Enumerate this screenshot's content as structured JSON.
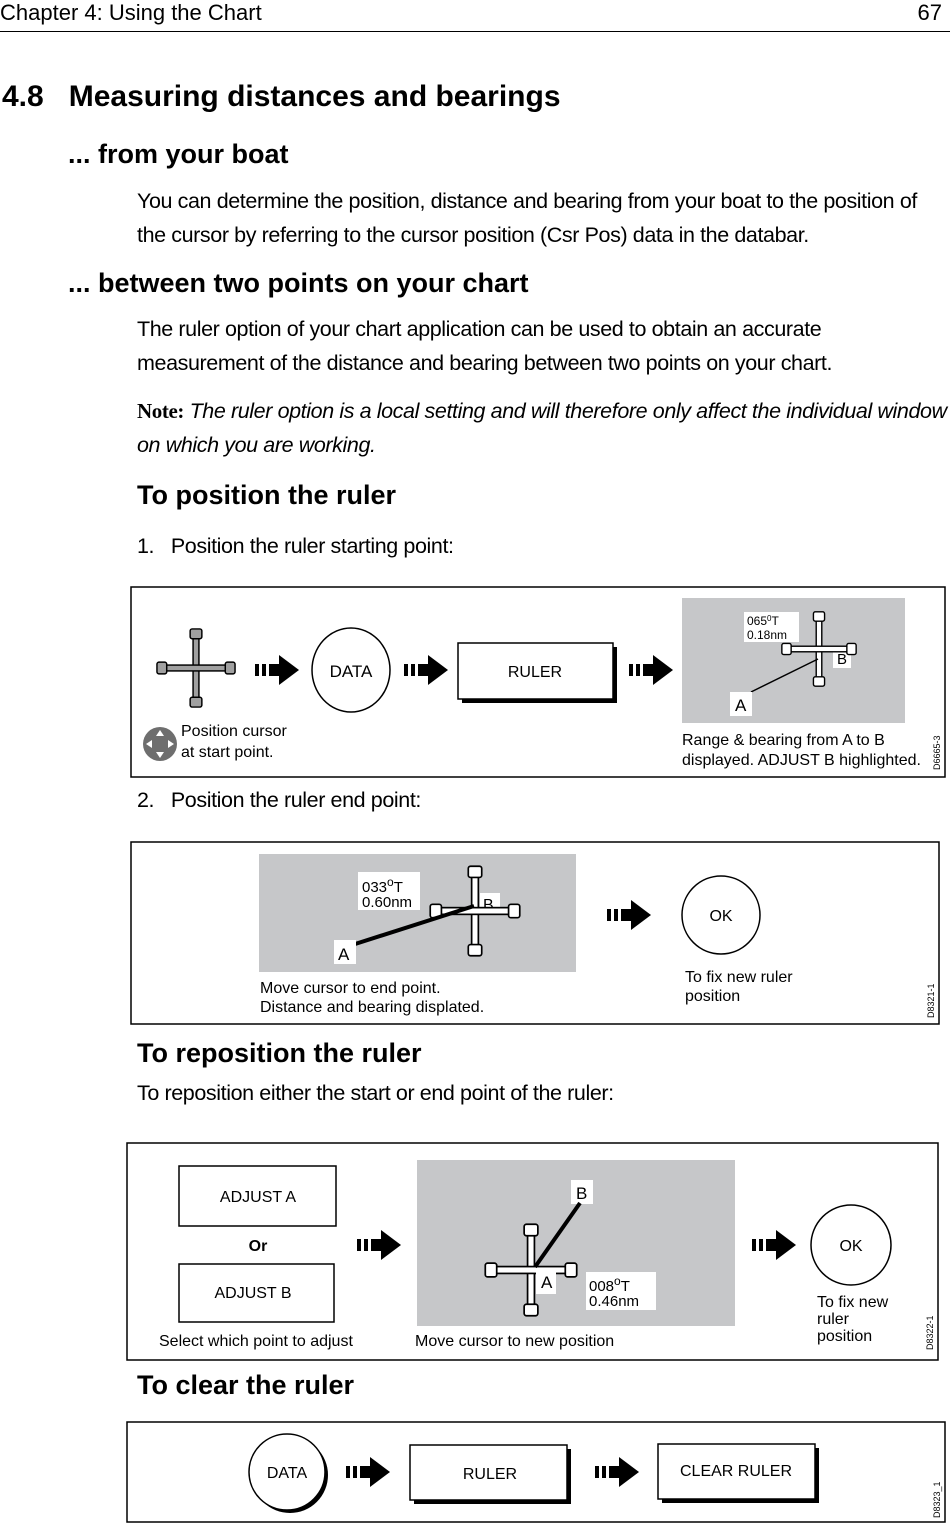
{
  "header": {
    "chapter": "Chapter 4: Using the Chart",
    "page_number": "67"
  },
  "section": {
    "title": "4.8   Measuring distances and bearings",
    "from_boat": {
      "heading": "... from your boat",
      "text": "You can determine the position, distance and bearing from your boat to the position of the cursor by referring to the cursor position (Csr Pos) data in the databar."
    },
    "between_points": {
      "heading": "... between two points on your chart",
      "text": "The ruler option of your chart application can be used to obtain an accurate measurement of the distance and bearing between two points on your chart.",
      "note_label": "Note:",
      "note_text": "The ruler option is a local setting and will therefore only affect the individual window on which you are working."
    },
    "position_ruler": {
      "heading": "To position the ruler",
      "step1": "1.   Position the ruler starting point:",
      "step2": "2.   Position the ruler end point:"
    },
    "reposition_ruler": {
      "heading": "To reposition the ruler",
      "text": "To reposition either the start or end point of the ruler:"
    },
    "clear_ruler": {
      "heading": "To clear the ruler"
    }
  },
  "figures": {
    "fig1": {
      "data_button": "DATA",
      "ruler_button": "RULER",
      "cursor_caption_1": "Position cursor",
      "cursor_caption_2": "at start point.",
      "bearing": "065",
      "bearing_unit": "0",
      "bearing_suffix": "T",
      "distance": "0.18nm",
      "point_a": "A",
      "point_b": "B",
      "caption_1": "Range & bearing from A to B",
      "caption_2": "displayed. ADJUST B highlighted.",
      "code": "D6665-3"
    },
    "fig2": {
      "bearing": "033",
      "bearing_unit": "o",
      "bearing_suffix": "T",
      "distance": "0.60nm",
      "point_a": "A",
      "point_b": "B",
      "caption_1": "Move cursor to end point.",
      "caption_2": "Distance and bearing displated.",
      "ok_button": "OK",
      "ok_caption_1": "To fix new ruler",
      "ok_caption_2": "position",
      "code": "D8321-1"
    },
    "fig3": {
      "adjust_a": "ADJUST A",
      "or": "Or",
      "adjust_b": "ADJUST B",
      "select_caption": "Select which point to adjust",
      "point_a": "A",
      "point_b": "B",
      "bearing": "008",
      "bearing_unit": "o",
      "bearing_suffix": "T",
      "distance": "0.46nm",
      "move_caption": "Move cursor to new position",
      "ok_button": "OK",
      "ok_caption_1": "To fix new",
      "ok_caption_2": "ruler",
      "ok_caption_3": "position",
      "code": "D8322-1"
    },
    "fig4": {
      "data_button": "DATA",
      "ruler_button": "RULER",
      "clear_button": "CLEAR RULER",
      "code": "D8323_1"
    }
  },
  "colors": {
    "chart_grey": "#c6c7c9",
    "cursor_grey": "#a0a0a0"
  }
}
